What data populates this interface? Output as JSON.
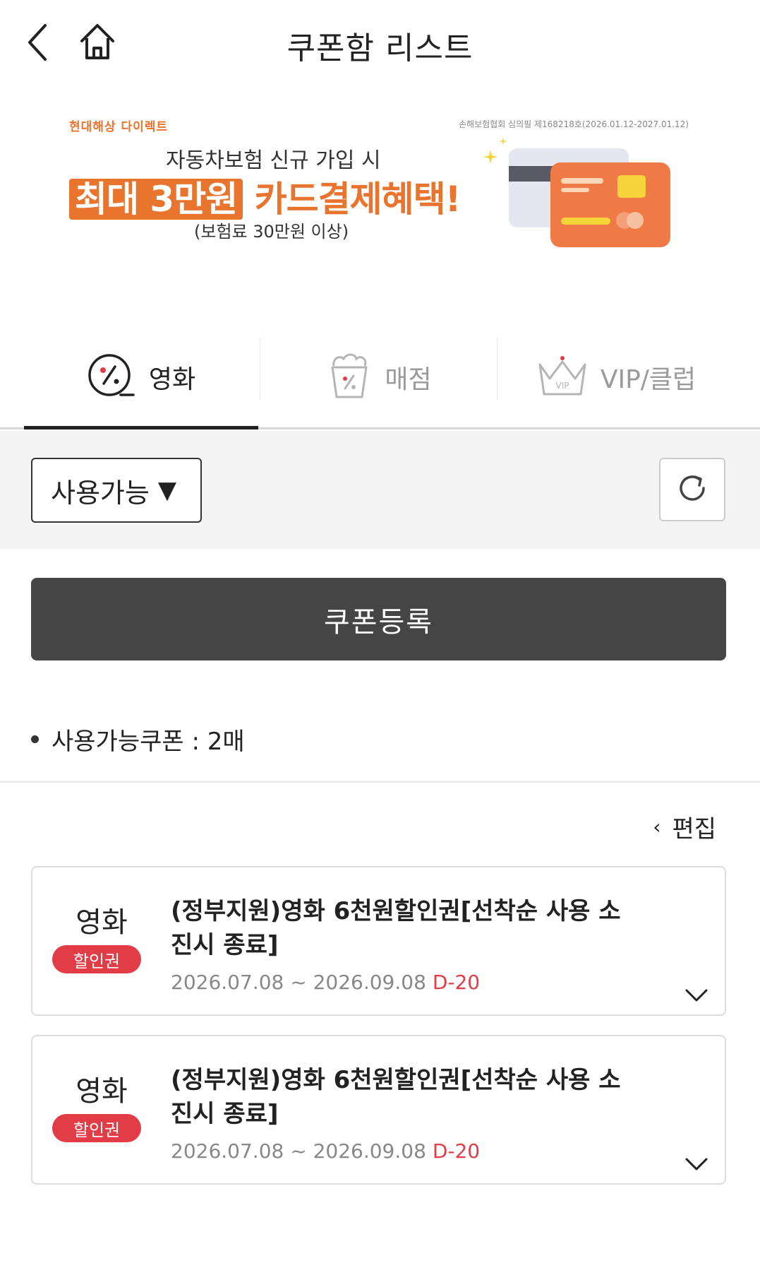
{
  "header": {
    "title": "쿠폰함 리스트",
    "back_icon": "back-chevron-icon",
    "home_icon": "home-icon"
  },
  "banner": {
    "brand": "현대해상 다이렉트",
    "registration": "손해보험협회 심의필 제168218호(2026.01.12-2027.01.12)",
    "line1": "자동차보험 신규 가입 시",
    "line2_highlight": "최대 3만원",
    "line2_rest": "카드결제혜택!",
    "line3": "(보험료 30만원 이상)",
    "accent_color": "#e8742d"
  },
  "tabs": [
    {
      "label": "영화",
      "icon": "discount-ticket-icon",
      "active": true
    },
    {
      "label": "매점",
      "icon": "popcorn-icon",
      "active": false
    },
    {
      "label": "VIP/클럽",
      "icon": "vip-crown-icon",
      "active": false
    }
  ],
  "filter": {
    "status_value": "사용가능",
    "status_arrow": "▼",
    "refresh_icon": "refresh-icon"
  },
  "register_button": "쿠폰등록",
  "coupon_count": {
    "text": "사용가능쿠폰 : 2매"
  },
  "edit": {
    "chevron": "‹",
    "label": "편집"
  },
  "coupons": [
    {
      "category": "영화",
      "badge": "할인권",
      "title": "(정부지원)영화 6천원할인권[선착순 사용 소진시 종료]",
      "period": "2026.07.08 ~ 2026.09.08",
      "dday": "D-20"
    },
    {
      "category": "영화",
      "badge": "할인권",
      "title": "(정부지원)영화 6천원할인권[선착순 사용 소진시 종료]",
      "period": "2026.07.08 ~ 2026.09.08",
      "dday": "D-20"
    }
  ],
  "colors": {
    "badge_red": "#e23d46",
    "register_bg": "#454545",
    "filter_bg": "#f4f4f4"
  }
}
